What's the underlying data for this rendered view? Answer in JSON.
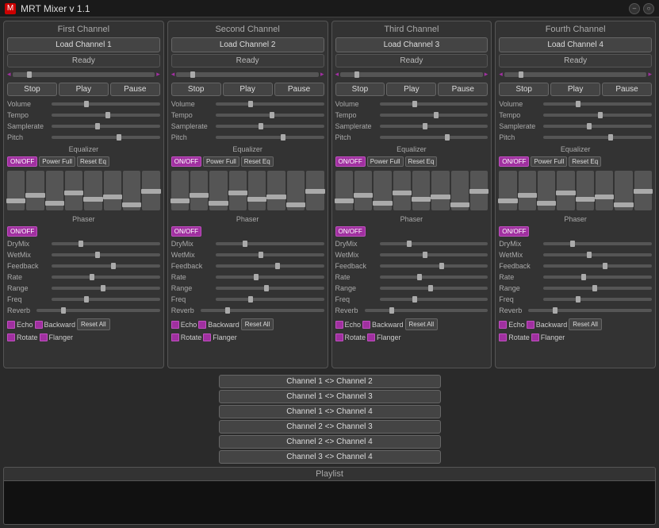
{
  "app": {
    "title": "MRT Mixer v 1.1",
    "icon": "M"
  },
  "titlebar": {
    "min_label": "–",
    "close_label": "○"
  },
  "channels": [
    {
      "id": "ch1",
      "name": "First Channel",
      "load_label": "Load Channel 1",
      "status": "Ready",
      "params": [
        "Volume",
        "Tempo",
        "Samplerate",
        "Pitch"
      ],
      "eq_onoff": "ON/OFF",
      "eq_power": "Power Full",
      "eq_reset": "Reset Eq",
      "phaser_label": "Phaser",
      "equalizer_label": "Equalizer",
      "phaser_onoff": "ON/OFF",
      "phaser_params": [
        "DryMix",
        "WetMix",
        "Feedback",
        "Rate",
        "Range",
        "Freq"
      ],
      "reverb_label": "Reverb",
      "echo_label": "Echo",
      "backward_label": "Backward",
      "rotate_label": "Rotate",
      "flanger_label": "Flanger",
      "reset_all_label": "Reset All",
      "stop_label": "Stop",
      "play_label": "Play",
      "pause_label": "Pause"
    },
    {
      "id": "ch2",
      "name": "Second Channel",
      "load_label": "Load Channel 2",
      "status": "Ready",
      "params": [
        "Volume",
        "Tempo",
        "Samplerate",
        "Pitch"
      ],
      "eq_onoff": "ON/OFF",
      "eq_power": "Power Full",
      "eq_reset": "Reset Eq",
      "phaser_label": "Phaser",
      "equalizer_label": "Equalizer",
      "phaser_onoff": "ON/OFF",
      "phaser_params": [
        "DryMix",
        "WetMix",
        "Feedback",
        "Rate",
        "Range",
        "Freq"
      ],
      "reverb_label": "Reverb",
      "echo_label": "Echo",
      "backward_label": "Backward",
      "rotate_label": "Rotate",
      "flanger_label": "Flanger",
      "reset_all_label": "Reset All",
      "stop_label": "Stop",
      "play_label": "Play",
      "pause_label": "Pause"
    },
    {
      "id": "ch3",
      "name": "Third Channel",
      "load_label": "Load Channel 3",
      "status": "Ready",
      "params": [
        "Volume",
        "Tempo",
        "Samplerate",
        "Pitch"
      ],
      "eq_onoff": "ON/OFF",
      "eq_power": "Power Full",
      "eq_reset": "Reset Eq",
      "phaser_label": "Phaser",
      "equalizer_label": "Equalizer",
      "phaser_onoff": "ON/OFF",
      "phaser_params": [
        "DryMix",
        "WetMix",
        "Feedback",
        "Rate",
        "Range",
        "Freq"
      ],
      "reverb_label": "Reverb",
      "echo_label": "Echo",
      "backward_label": "Backward",
      "rotate_label": "Rotate",
      "flanger_label": "Flanger",
      "reset_all_label": "Reset All",
      "stop_label": "Stop",
      "play_label": "Play",
      "pause_label": "Pause"
    },
    {
      "id": "ch4",
      "name": "Fourth Channel",
      "load_label": "Load Channel 4",
      "status": "Ready",
      "params": [
        "Volume",
        "Tempo",
        "Samplerate",
        "Pitch"
      ],
      "eq_onoff": "ON/OFF",
      "eq_power": "Power Full",
      "eq_reset": "Reset Eq",
      "phaser_label": "Phaser",
      "equalizer_label": "Equalizer",
      "phaser_onoff": "ON/OFF",
      "phaser_params": [
        "DryMix",
        "WetMix",
        "Feedback",
        "Rate",
        "Range",
        "Freq"
      ],
      "reverb_label": "Reverb",
      "echo_label": "Echo",
      "backward_label": "Backward",
      "rotate_label": "Rotate",
      "flanger_label": "Flanger",
      "reset_all_label": "Reset All",
      "stop_label": "Stop",
      "play_label": "Play",
      "pause_label": "Pause"
    }
  ],
  "channel_links": [
    "Channel 1 <> Channel 2",
    "Channel 1 <> Channel 3",
    "Channel 1 <> Channel 4",
    "Channel 2 <> Channel 3",
    "Channel 2 <> Channel 4",
    "Channel 3 <> Channel 4"
  ],
  "playlist_label": "Playlist"
}
